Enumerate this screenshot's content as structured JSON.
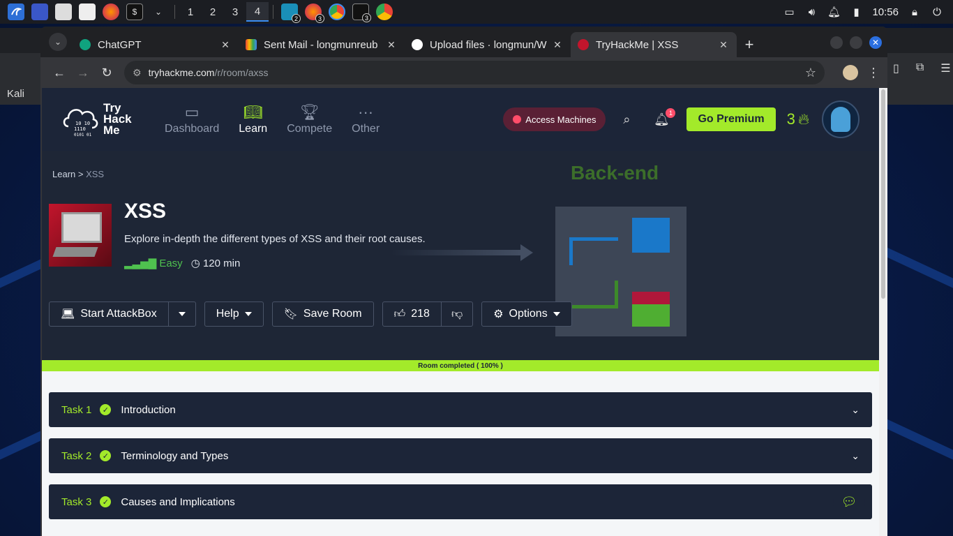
{
  "taskbar": {
    "workspaces": [
      "1",
      "2",
      "3",
      "4"
    ],
    "active_workspace": "4",
    "badges": {
      "app1": "2",
      "app2": "3",
      "app3": "3"
    },
    "clock": "10:56"
  },
  "background_window": {
    "bookmark": "Kali"
  },
  "browser": {
    "tabs": [
      {
        "title": "ChatGPT",
        "favicon": "chatgpt-icon",
        "active": false
      },
      {
        "title": "Sent Mail - longmunreub",
        "favicon": "gmail-icon",
        "active": false
      },
      {
        "title": "Upload files · longmun/W",
        "favicon": "github-icon",
        "active": false
      },
      {
        "title": "TryHackMe | XSS",
        "favicon": "tryhackme-icon",
        "active": true
      }
    ],
    "url_host": "tryhackme.com",
    "url_path": "/r/room/axss"
  },
  "nav": {
    "logo_line1": "Try",
    "logo_line2": "Hack",
    "logo_line3": "Me",
    "items": [
      {
        "label": "Dashboard",
        "icon": "dashboard-icon"
      },
      {
        "label": "Learn",
        "icon": "book-icon"
      },
      {
        "label": "Compete",
        "icon": "trophy-icon"
      },
      {
        "label": "Other",
        "icon": "more-icon"
      }
    ],
    "active_item": "Learn",
    "access_label": "Access Machines",
    "notifications": "1",
    "premium_label": "Go Premium",
    "streak": "3"
  },
  "room": {
    "breadcrumb_root": "Learn",
    "breadcrumb_sep": ">",
    "breadcrumb_current": "XSS",
    "title": "XSS",
    "description": "Explore in-depth the different types of XSS and their root causes.",
    "difficulty": "Easy",
    "duration": "120 min",
    "banner_word": "Back-end",
    "actions": {
      "start": "Start AttackBox",
      "help": "Help",
      "save": "Save Room",
      "likes": "218",
      "options": "Options"
    },
    "progress_text": "Room completed ( 100% )",
    "progress_value": 100
  },
  "tasks": [
    {
      "num": "Task 1",
      "name": "Introduction"
    },
    {
      "num": "Task 2",
      "name": "Terminology and Types"
    },
    {
      "num": "Task 3",
      "name": "Causes and Implications"
    }
  ],
  "colors": {
    "accent": "#a3ea2a",
    "navy": "#1c2538",
    "danger": "#ff4d6a"
  }
}
